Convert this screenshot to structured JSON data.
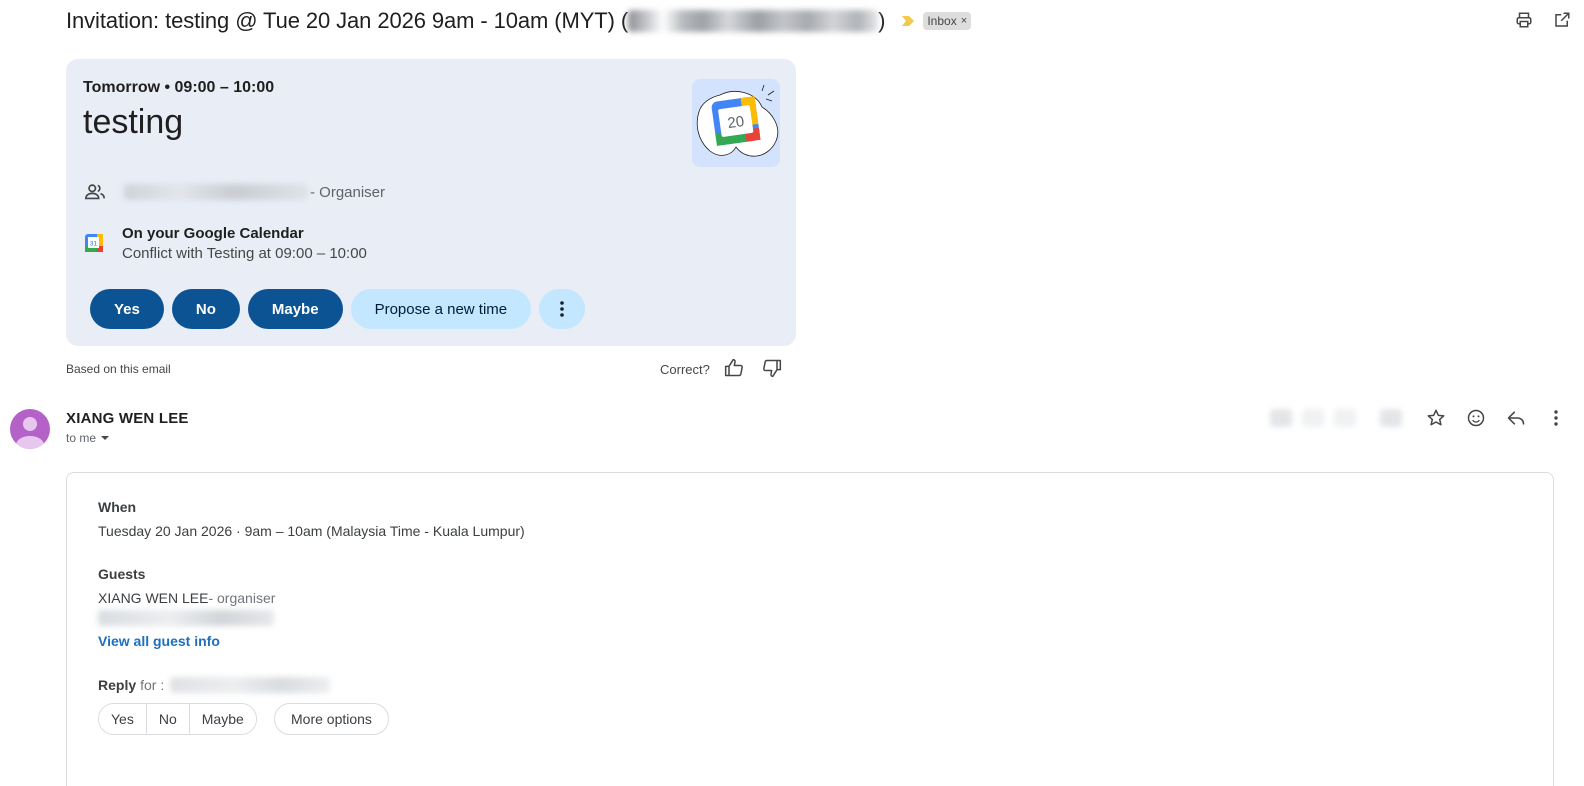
{
  "subject": {
    "text": "Invitation: testing @ Tue 20 Jan 2026 9am - 10am (MYT) (",
    "closing": ")",
    "label_chip": "Inbox",
    "chip_close": "×"
  },
  "top_icons": [
    "print-icon",
    "open-in-new-window-icon"
  ],
  "smart_card": {
    "when": "Tomorrow • 09:00 – 10:00",
    "title": "testing",
    "organiser_role": "- Organiser",
    "calendar_title": "On your Google Calendar",
    "calendar_conflict": "Conflict with Testing at 09:00 – 10:00",
    "illustration_day": "20",
    "mini_calendar_day": "31",
    "buttons": {
      "yes": "Yes",
      "no": "No",
      "maybe": "Maybe",
      "propose": "Propose a new time"
    }
  },
  "feedback": {
    "based_on": "Based on this email",
    "correct": "Correct?"
  },
  "sender": {
    "name": "XIANG WEN LEE",
    "to": "to me"
  },
  "invite": {
    "when_label": "When",
    "when_value": "Tuesday 20 Jan 2026 · 9am – 10am (Malaysia Time - Kuala Lumpur)",
    "guests_label": "Guests",
    "guest_name": "XIANG WEN LEE",
    "guest_role": "- organiser",
    "view_all": "View all guest info",
    "reply_label": "Reply",
    "reply_for": "for :",
    "reply_buttons": {
      "yes": "Yes",
      "no": "No",
      "maybe": "Maybe"
    },
    "more_options": "More options"
  },
  "colors": {
    "card_bg": "#e9eef6",
    "pill_dark": "#0c5394",
    "pill_light": "#c2e7ff",
    "avatar": "#b462c7",
    "link": "#1f6fbf",
    "importance": "#f2c94c"
  }
}
